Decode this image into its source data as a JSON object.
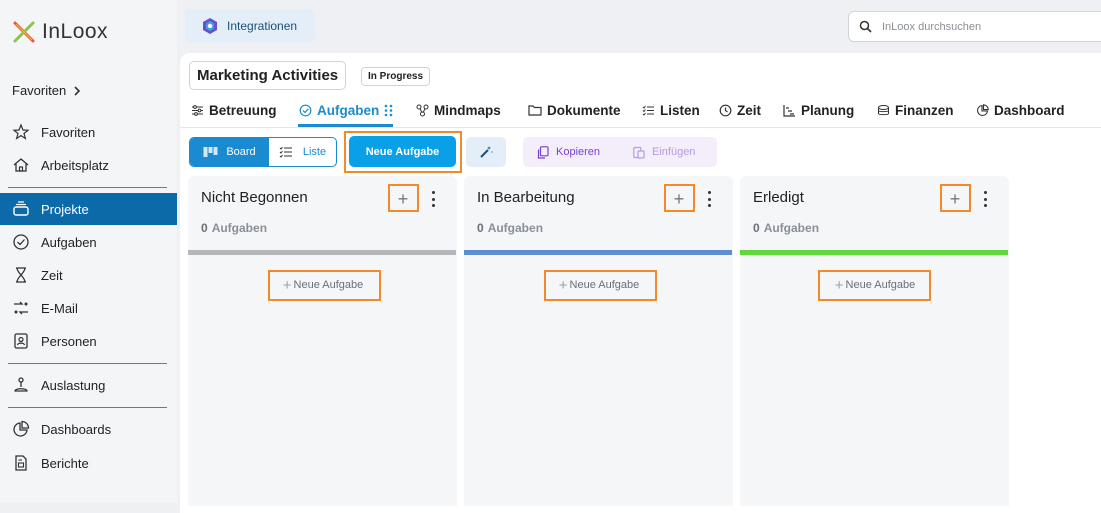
{
  "app": {
    "logo_text": "InLoox"
  },
  "sidebar": {
    "favorites_header": "Favoriten",
    "items": [
      {
        "label": "Favoriten"
      },
      {
        "label": "Arbeitsplatz"
      },
      {
        "label": "Projekte"
      },
      {
        "label": "Aufgaben"
      },
      {
        "label": "Zeit"
      },
      {
        "label": "E-Mail"
      },
      {
        "label": "Personen"
      },
      {
        "label": "Auslastung"
      },
      {
        "label": "Dashboards"
      },
      {
        "label": "Berichte"
      }
    ]
  },
  "header": {
    "integrations_label": "Integrationen",
    "search_placeholder": "InLoox durchsuchen"
  },
  "project": {
    "title": "Marketing Activities",
    "status": "In Progress"
  },
  "tabs": [
    {
      "label": "Betreuung"
    },
    {
      "label": "Aufgaben"
    },
    {
      "label": "Mindmaps"
    },
    {
      "label": "Dokumente"
    },
    {
      "label": "Listen"
    },
    {
      "label": "Zeit"
    },
    {
      "label": "Planung"
    },
    {
      "label": "Finanzen"
    },
    {
      "label": "Dashboard"
    }
  ],
  "toolbar": {
    "board_label": "Board",
    "list_label": "Liste",
    "new_task_label": "Neue Aufgabe",
    "copy_label": "Kopieren",
    "paste_label": "Einfügen"
  },
  "columns": [
    {
      "title": "Nicht Begonnen",
      "count": "0",
      "count_label": "Aufgaben",
      "color": "#b4b6b9",
      "add_label": "Neue Aufgabe"
    },
    {
      "title": "In Bearbeitung",
      "count": "0",
      "count_label": "Aufgaben",
      "color": "#5b8fd1",
      "add_label": "Neue Aufgabe"
    },
    {
      "title": "Erledigt",
      "count": "0",
      "count_label": "Aufgaben",
      "color": "#5fd83a",
      "add_label": "Neue Aufgabe"
    }
  ],
  "colors": {
    "accent": "#1a8bd0",
    "active_nav": "#0d6aa8",
    "highlight": "#f28a2c",
    "primary_button": "#0aa0e8"
  }
}
